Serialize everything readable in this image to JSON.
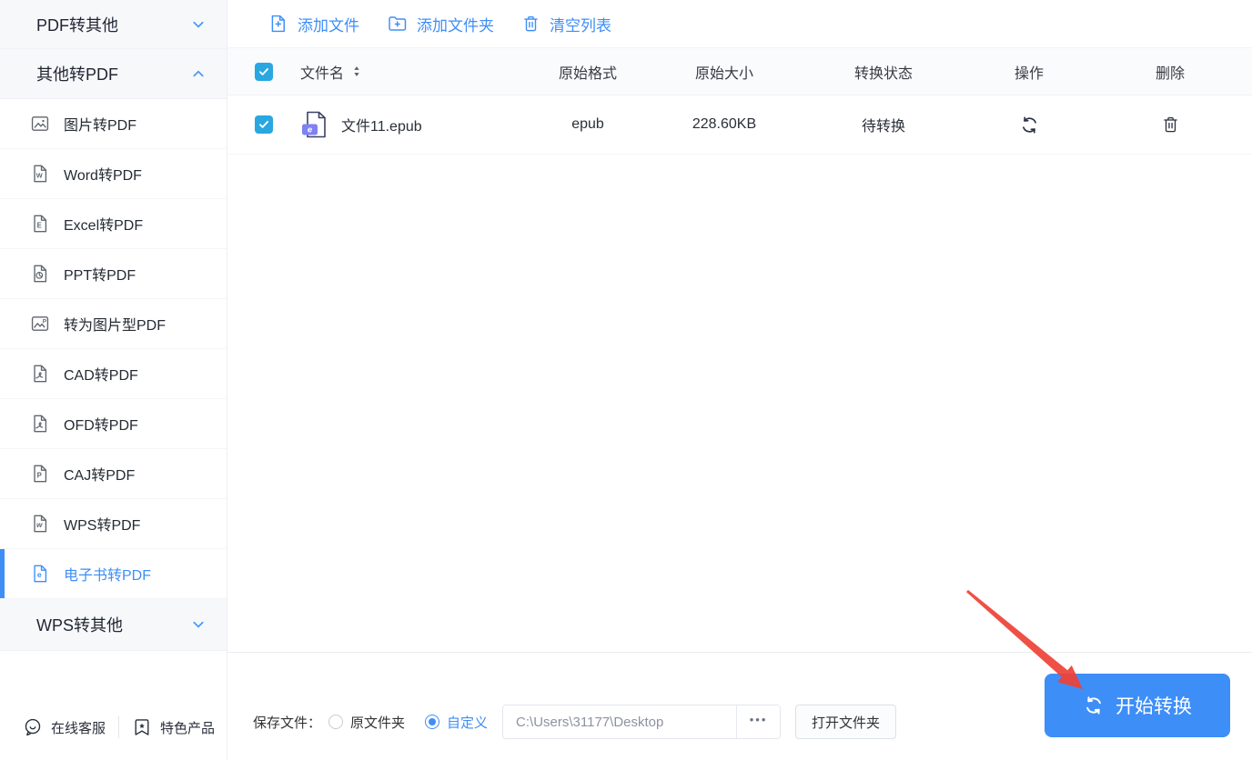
{
  "colors": {
    "primary_blue": "#3E8EF7",
    "checkbox_cyan": "#29A7E1",
    "epub_badge_purple": "#7E82F2",
    "annotation_arrow_red": "#EE4135"
  },
  "sidebar": {
    "sections": [
      {
        "label": "PDF转其他",
        "state": "collapsed"
      },
      {
        "label": "其他转PDF",
        "state": "expanded"
      },
      {
        "label": "WPS转其他",
        "state": "collapsed"
      }
    ],
    "items": [
      {
        "label": "图片转PDF"
      },
      {
        "label": "Word转PDF"
      },
      {
        "label": "Excel转PDF"
      },
      {
        "label": "PPT转PDF"
      },
      {
        "label": "转为图片型PDF"
      },
      {
        "label": "CAD转PDF"
      },
      {
        "label": "OFD转PDF"
      },
      {
        "label": "CAJ转PDF"
      },
      {
        "label": "WPS转PDF"
      },
      {
        "label": "电子书转PDF",
        "selected": true
      }
    ],
    "footer": {
      "support": "在线客服",
      "products": "特色产品"
    }
  },
  "toolbar": {
    "add_file": "添加文件",
    "add_folder": "添加文件夹",
    "clear_list": "清空列表"
  },
  "table": {
    "headers": {
      "name": "文件名",
      "format": "原始格式",
      "size": "原始大小",
      "status": "转换状态",
      "action": "操作",
      "delete": "删除"
    },
    "select_all_checked": true,
    "rows": [
      {
        "name": "文件11.epub",
        "badge_letter": "e",
        "format": "epub",
        "size": "228.60KB",
        "status": "待转换",
        "checked": true
      }
    ]
  },
  "bottom_bar": {
    "save_label": "保存文件：",
    "radio_original": {
      "label": "原文件夹",
      "checked": false
    },
    "radio_custom": {
      "label": "自定义",
      "checked": true
    },
    "path_value": "C:\\Users\\31177\\Desktop",
    "browse_label": "•••",
    "open_folder": "打开文件夹",
    "convert": "开始转换"
  }
}
